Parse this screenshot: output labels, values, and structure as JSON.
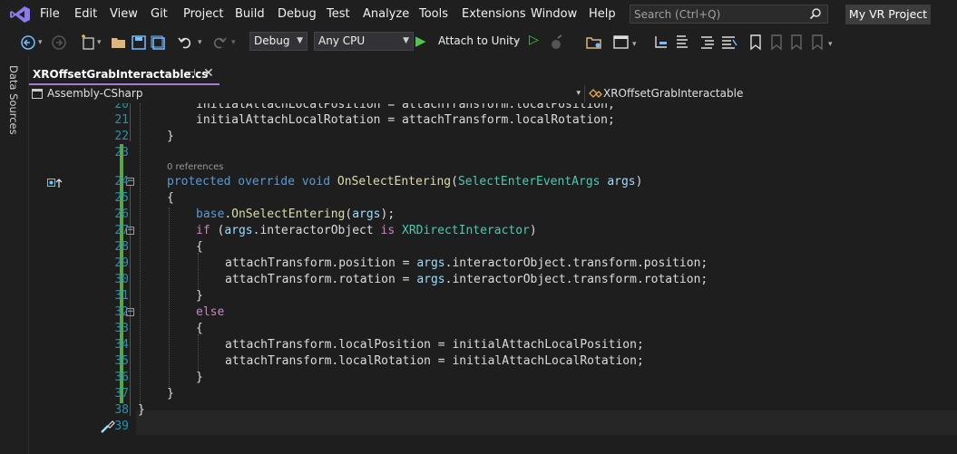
{
  "menu": [
    "File",
    "Edit",
    "View",
    "Git",
    "Project",
    "Build",
    "Debug",
    "Test",
    "Analyze",
    "Tools",
    "Extensions",
    "Window",
    "Help"
  ],
  "search": {
    "placeholder": "Search (Ctrl+Q)"
  },
  "project_name": "My VR Project",
  "toolbar": {
    "config": "Debug",
    "platform": "Any CPU",
    "attach_label": "Attach to Unity"
  },
  "side_panel": {
    "label": "Data Sources"
  },
  "tab": {
    "filename": "XROffsetGrabInteractable.cs"
  },
  "nav": {
    "assembly": "Assembly-CSharp",
    "class": "XROffsetGrabInteractable"
  },
  "editor": {
    "references": "0 references",
    "lines": [
      {
        "n": "20",
        "text": "initialAttachLocalPosition = attachTransform.localPosition;"
      },
      {
        "n": "21",
        "text": "initialAttachLocalRotation = attachTransform.localRotation;"
      },
      {
        "n": "22",
        "text": "}"
      },
      {
        "n": "23",
        "text": ""
      },
      {
        "n": "24",
        "text": "protected override void OnSelectEntering(SelectEnterEventArgs args)"
      },
      {
        "n": "25",
        "text": "{"
      },
      {
        "n": "26",
        "text": "base.OnSelectEntering(args);"
      },
      {
        "n": "27",
        "text": "if (args.interactorObject is XRDirectInteractor)"
      },
      {
        "n": "28",
        "text": "{"
      },
      {
        "n": "29",
        "text": "attachTransform.position = args.interactorObject.transform.position;"
      },
      {
        "n": "30",
        "text": "attachTransform.rotation = args.interactorObject.transform.rotation;"
      },
      {
        "n": "31",
        "text": "}"
      },
      {
        "n": "32",
        "text": "else"
      },
      {
        "n": "33",
        "text": "{"
      },
      {
        "n": "34",
        "text": "attachTransform.localPosition = initialAttachLocalPosition;"
      },
      {
        "n": "35",
        "text": "attachTransform.localRotation = initialAttachLocalRotation;"
      },
      {
        "n": "36",
        "text": "}"
      },
      {
        "n": "37",
        "text": "}"
      },
      {
        "n": "38",
        "text": "}"
      },
      {
        "n": "39",
        "text": ""
      }
    ]
  }
}
